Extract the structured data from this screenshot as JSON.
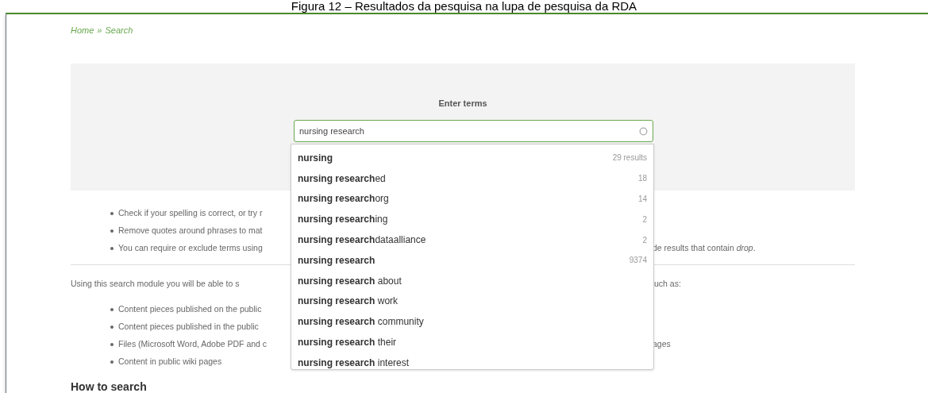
{
  "caption": "Figura 12 – Resultados da pesquisa na lupa de pesquisa da RDA",
  "breadcrumb": {
    "items": [
      "Home",
      "Search"
    ],
    "separator": "»"
  },
  "search": {
    "label": "Enter terms",
    "value": "nursing research"
  },
  "suggestions": [
    {
      "text": "**nursing**",
      "count": "29 results"
    },
    {
      "text": "**nursing research**ed",
      "count": "18"
    },
    {
      "text": "**nursing research**org",
      "count": "14"
    },
    {
      "text": "**nursing research**ing",
      "count": "2"
    },
    {
      "text": "**nursing research**dataalliance",
      "count": "2"
    },
    {
      "text": "**nursing research**",
      "count": "9374"
    },
    {
      "text": "**nursing research** about"
    },
    {
      "text": "**nursing research** work"
    },
    {
      "text": "**nursing research** community"
    },
    {
      "text": "**nursing research** their"
    },
    {
      "text": "**nursing research** interest"
    }
  ],
  "tips": [
    {
      "left": "Check if your spelling is correct, or try r"
    },
    {
      "left": "Remove quotes around phrases to mat"
    },
    {
      "left": "You can require or exclude terms using",
      "right": "de results that contain *drop*."
    }
  ],
  "intro": {
    "left": "Using this search module you will be able to s",
    "right": "uch as:"
  },
  "sources": [
    {
      "left": "Content pieces published on the public"
    },
    {
      "left": "Content pieces published in the public"
    },
    {
      "left": "Files (Microsoft Word, Adobe PDF and c",
      "right": "ages"
    },
    {
      "left": "Content in public wiki pages"
    }
  ],
  "heading": "How to search"
}
